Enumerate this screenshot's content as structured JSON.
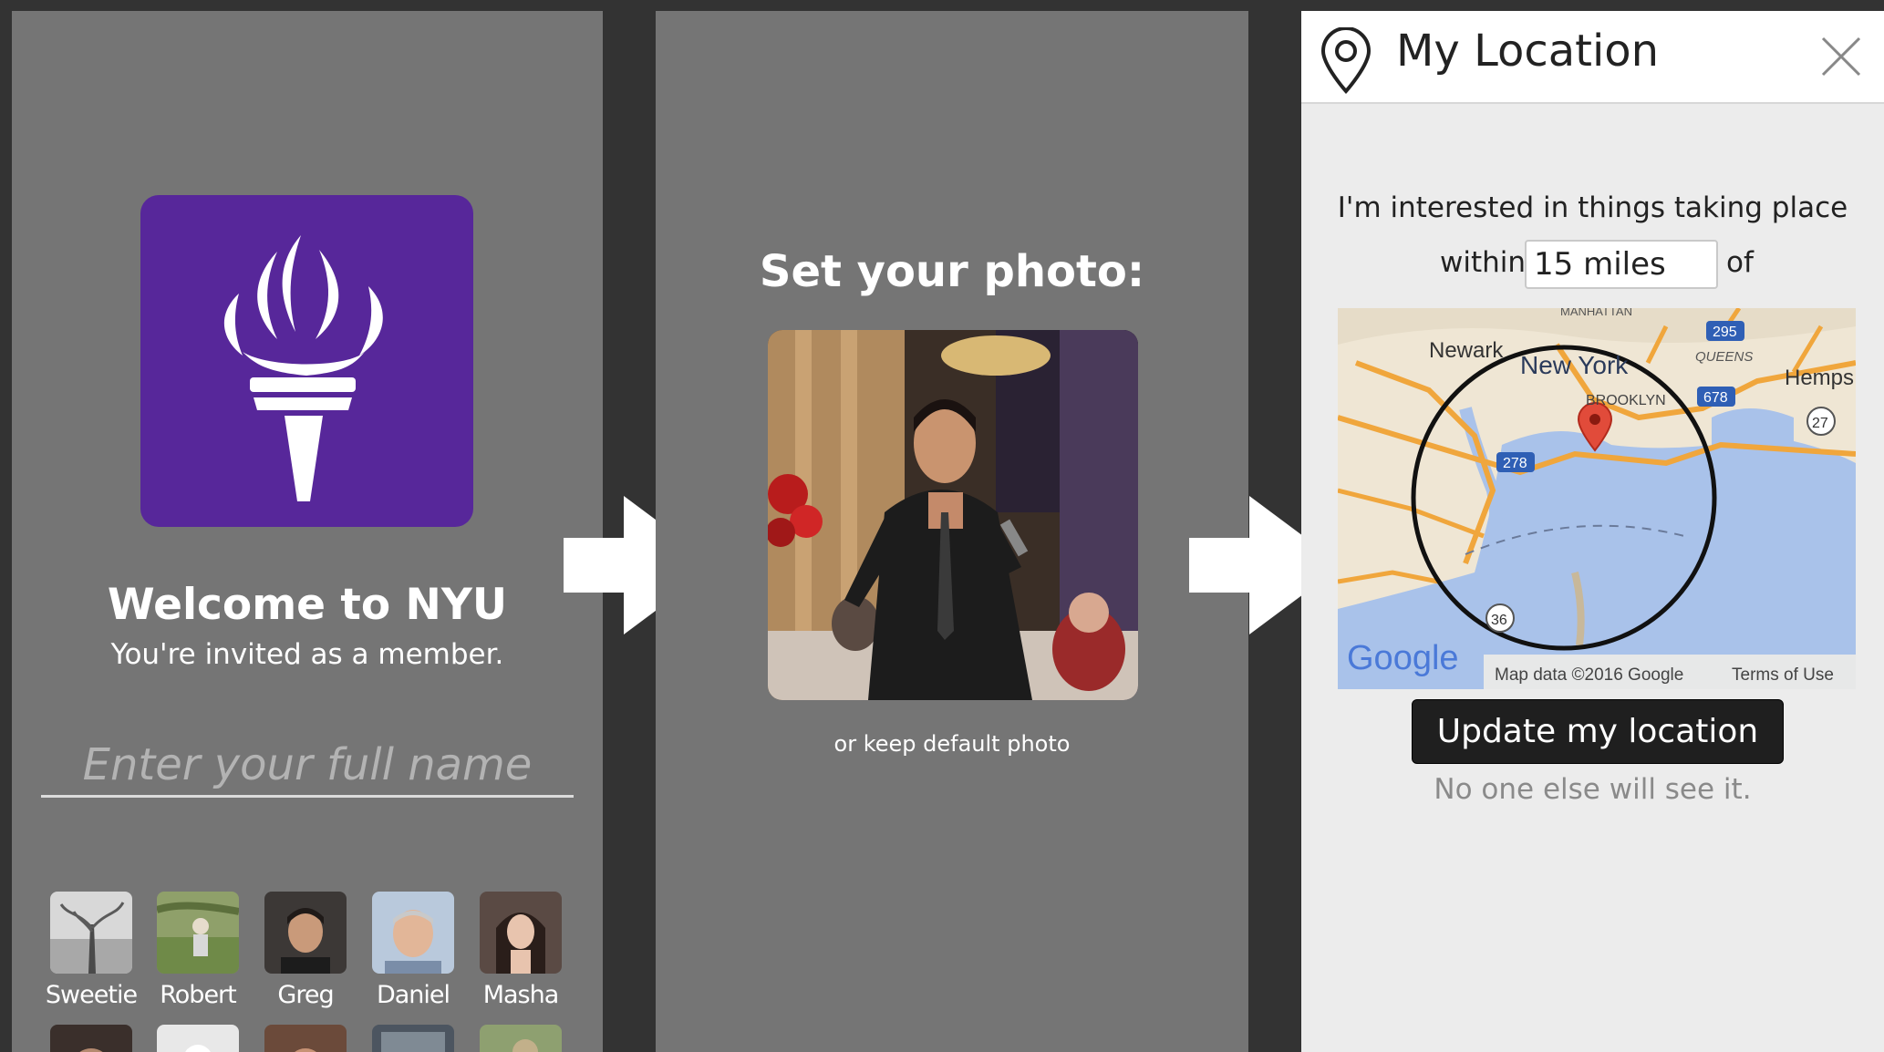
{
  "colors": {
    "background": "#333333",
    "panel_gray": "#757575",
    "nyu_purple": "#57279a",
    "dialog_bg": "#ececec",
    "button_dark": "#1f1f1f"
  },
  "screen1": {
    "logo_icon": "nyu-torch-icon",
    "welcome_title": "Welcome to NYU",
    "invite_text": "You're invited as a member.",
    "name_placeholder": "Enter your full name",
    "members": [
      "Sweetie",
      "Robert",
      "Greg",
      "Daniel",
      "Masha"
    ]
  },
  "screen2": {
    "title": "Set your photo:",
    "keep_default": "or keep default photo"
  },
  "screen3": {
    "title": "My Location",
    "interest_text": "I'm interested in things taking place",
    "within_label": "within",
    "radius_value": "15 miles",
    "of_label": "of",
    "map": {
      "labels": {
        "newark": "Newark",
        "new_york": "New York",
        "brooklyn": "BROOKLYN",
        "queens": "QUEENS",
        "manhattan": "MANHATTAN",
        "hempstead": "Hemps",
        "route_295": "295",
        "route_678": "678",
        "route_278": "278",
        "route_27": "27",
        "route_36": "36"
      },
      "google_logo": "Google",
      "attribution": "Map data ©2016 Google",
      "terms": "Terms of Use"
    },
    "update_button": "Update my location",
    "privacy_note": "No one else will see it."
  }
}
